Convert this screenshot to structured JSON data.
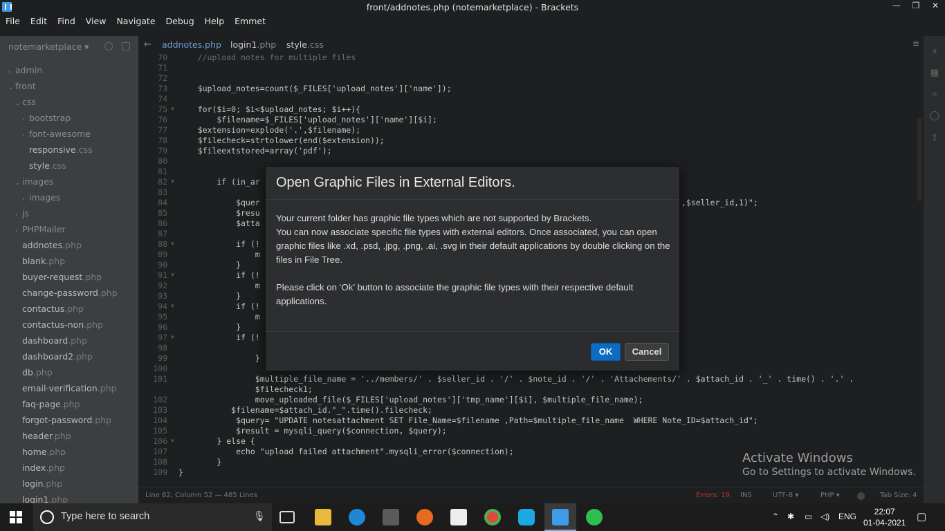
{
  "window": {
    "title": "front/addnotes.php (notemarketplace) - Brackets",
    "controls": [
      "—",
      "❐",
      "✕"
    ]
  },
  "menu": [
    "File",
    "Edit",
    "Find",
    "View",
    "Navigate",
    "Debug",
    "Help",
    "Emmet"
  ],
  "sidebar": {
    "project": "notemarketplace ▾",
    "items": [
      {
        "name": "admin",
        "ext": "",
        "indent": 0,
        "arrow": "›"
      },
      {
        "name": "front",
        "ext": "",
        "indent": 0,
        "arrow": "⌄"
      },
      {
        "name": "css",
        "ext": "",
        "indent": 1,
        "arrow": "⌄"
      },
      {
        "name": "bootstrap",
        "ext": "",
        "indent": 2,
        "arrow": "›"
      },
      {
        "name": "font-awesome",
        "ext": "",
        "indent": 2,
        "arrow": "›"
      },
      {
        "name": "responsive",
        "ext": ".css",
        "indent": 2,
        "arrow": ""
      },
      {
        "name": "style",
        "ext": ".css",
        "indent": 2,
        "arrow": ""
      },
      {
        "name": "images",
        "ext": "",
        "indent": 1,
        "arrow": "⌄"
      },
      {
        "name": "images",
        "ext": "",
        "indent": 2,
        "arrow": "›"
      },
      {
        "name": "js",
        "ext": "",
        "indent": 1,
        "arrow": "›"
      },
      {
        "name": "PHPMailer",
        "ext": "",
        "indent": 1,
        "arrow": "›"
      },
      {
        "name": "addnotes",
        "ext": ".php",
        "indent": 1,
        "arrow": ""
      },
      {
        "name": "blank",
        "ext": ".php",
        "indent": 1,
        "arrow": ""
      },
      {
        "name": "buyer-request",
        "ext": ".php",
        "indent": 1,
        "arrow": ""
      },
      {
        "name": "change-password",
        "ext": ".php",
        "indent": 1,
        "arrow": ""
      },
      {
        "name": "contactus",
        "ext": ".php",
        "indent": 1,
        "arrow": ""
      },
      {
        "name": "contactus-non",
        "ext": ".php",
        "indent": 1,
        "arrow": ""
      },
      {
        "name": "dashboard",
        "ext": ".php",
        "indent": 1,
        "arrow": ""
      },
      {
        "name": "dashboard2",
        "ext": ".php",
        "indent": 1,
        "arrow": ""
      },
      {
        "name": "db",
        "ext": ".php",
        "indent": 1,
        "arrow": ""
      },
      {
        "name": "email-verification",
        "ext": ".php",
        "indent": 1,
        "arrow": ""
      },
      {
        "name": "faq-page",
        "ext": ".php",
        "indent": 1,
        "arrow": ""
      },
      {
        "name": "forgot-password",
        "ext": ".php",
        "indent": 1,
        "arrow": ""
      },
      {
        "name": "header",
        "ext": ".php",
        "indent": 1,
        "arrow": ""
      },
      {
        "name": "home",
        "ext": ".php",
        "indent": 1,
        "arrow": ""
      },
      {
        "name": "index",
        "ext": ".php",
        "indent": 1,
        "arrow": ""
      },
      {
        "name": "login",
        "ext": ".php",
        "indent": 1,
        "arrow": ""
      },
      {
        "name": "login1",
        "ext": ".php",
        "indent": 1,
        "arrow": ""
      }
    ]
  },
  "tabs": [
    {
      "name": "addnotes",
      "ext": ".php",
      "active": true
    },
    {
      "name": "login1",
      "ext": ".php",
      "active": false
    },
    {
      "name": "style",
      "ext": ".css",
      "active": false
    }
  ],
  "editor": {
    "lines": [
      {
        "n": "70",
        "fold": "",
        "code": "    //upload notes for multiple files",
        "cls": "c"
      },
      {
        "n": "71",
        "fold": "",
        "code": ""
      },
      {
        "n": "72",
        "fold": "",
        "code": ""
      },
      {
        "n": "73",
        "fold": "",
        "code": "    $upload_notes=count($_FILES['upload_notes']['name']);"
      },
      {
        "n": "74",
        "fold": "",
        "code": ""
      },
      {
        "n": "75",
        "fold": "▼",
        "code": "    for($i=0; $i<$upload_notes; $i++){"
      },
      {
        "n": "76",
        "fold": "",
        "code": "        $filename=$_FILES['upload_notes']['name'][$i];"
      },
      {
        "n": "77",
        "fold": "",
        "code": "    $extension=explode('.',$filename);"
      },
      {
        "n": "78",
        "fold": "",
        "code": "    $filecheck=strtolower(end($extension));"
      },
      {
        "n": "79",
        "fold": "",
        "code": "    $fileextstored=array('pdf');"
      },
      {
        "n": "80",
        "fold": "",
        "code": ""
      },
      {
        "n": "81",
        "fold": "",
        "code": ""
      },
      {
        "n": "82",
        "fold": "▼",
        "code": "        if (in_ar"
      },
      {
        "n": "83",
        "fold": "",
        "code": ""
      },
      {
        "n": "84",
        "fold": "",
        "code": "            $quer                                                                              e_id,NOW(),$seller_id,1)\";"
      },
      {
        "n": "85",
        "fold": "",
        "code": "            $resu"
      },
      {
        "n": "86",
        "fold": "",
        "code": "            $atta"
      },
      {
        "n": "87",
        "fold": "",
        "code": ""
      },
      {
        "n": "88",
        "fold": "▼",
        "code": "            if (!"
      },
      {
        "n": "89",
        "fold": "",
        "code": "                m"
      },
      {
        "n": "90",
        "fold": "",
        "code": "            }"
      },
      {
        "n": "91",
        "fold": "▼",
        "code": "            if (!"
      },
      {
        "n": "92",
        "fold": "",
        "code": "                m"
      },
      {
        "n": "93",
        "fold": "",
        "code": "            }"
      },
      {
        "n": "94",
        "fold": "▼",
        "code": "            if (!"
      },
      {
        "n": "95",
        "fold": "",
        "code": "                m"
      },
      {
        "n": "96",
        "fold": "",
        "code": "            }"
      },
      {
        "n": "97",
        "fold": "▼",
        "code": "            if (!"
      },
      {
        "n": "98",
        "fold": "",
        "code": ""
      },
      {
        "n": "99",
        "fold": "",
        "code": "                }"
      },
      {
        "n": "100",
        "fold": "",
        "code": ""
      },
      {
        "n": "101",
        "fold": "",
        "code": "                $multiple_file_name = '../members/' . $seller_id . '/' . $note_id . '/' . 'Attachements/' . $attach_id . '_' . time() . '.' ."
      },
      {
        "n": "",
        "fold": "",
        "code": "                $filecheck1;"
      },
      {
        "n": "102",
        "fold": "",
        "code": "                move_uploaded_file($_FILES['upload_notes']['tmp_name'][$i], $multiple_file_name);"
      },
      {
        "n": "103",
        "fold": "",
        "code": "           $filename=$attach_id.\"_\".time().filecheck;"
      },
      {
        "n": "104",
        "fold": "",
        "code": "            $query= \"UPDATE notesattachment SET File_Name=$filename ,Path=$multiple_file_name  WHERE Note_ID=$attach_id\";"
      },
      {
        "n": "105",
        "fold": "",
        "code": "            $result = mysqli_query($connection, $query);"
      },
      {
        "n": "106",
        "fold": "▼",
        "code": "        } else {"
      },
      {
        "n": "107",
        "fold": "",
        "code": "            echo \"upload failed attachment\".mysqli_error($connection);"
      },
      {
        "n": "108",
        "fold": "",
        "code": "        }"
      },
      {
        "n": "109",
        "fold": "",
        "code": "}"
      }
    ]
  },
  "statusbar": {
    "position": "Line 82, Column 52 — 485 Lines",
    "errors": "Errors: 19",
    "mode": "INS",
    "encoding": "UTF-8 ▾",
    "language": "PHP ▾",
    "tabsize": "Tab Size: 4"
  },
  "watermark": {
    "line1": "Activate Windows",
    "line2": "Go to Settings to activate Windows."
  },
  "dialog": {
    "title": "Open Graphic Files in External Editors.",
    "para1_line1": "Your current folder has graphic file types which are not supported by Brackets.",
    "para1_line2": "You can now associate specific file types with external editors. Once associated, you can open graphic files like .xd, .psd, .jpg, .png, .ai, .svg in their default applications by double clicking on the files in File Tree.",
    "para2": "Please click on ‘Ok’ button to associate the graphic file types with their respective default applications.",
    "ok_label": "OK",
    "cancel_label": "Cancel"
  },
  "taskbar": {
    "search_placeholder": "Type here to search",
    "language": "ENG",
    "time": "22:07",
    "date": "01-04-2021"
  },
  "colors": {
    "accent": "#0d6cc2",
    "sidebar_bg": "#3c3f41",
    "editor_bg": "#1d1f21"
  }
}
